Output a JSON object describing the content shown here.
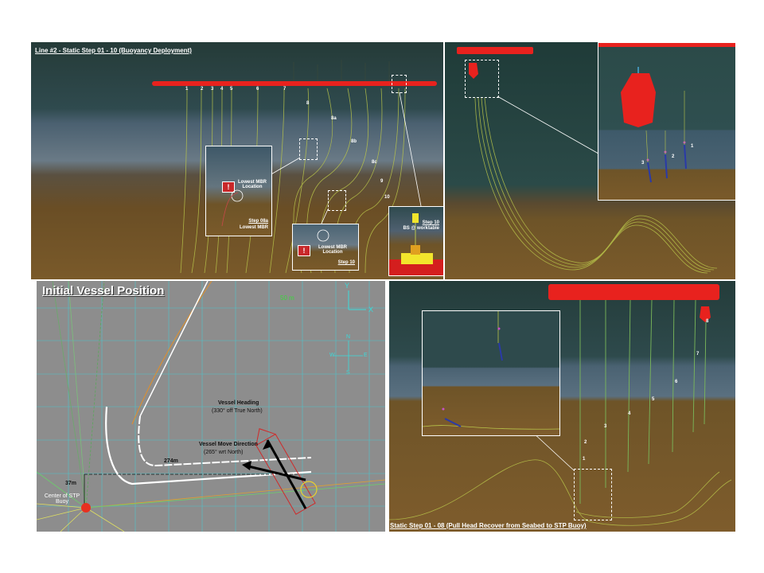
{
  "panel1": {
    "title": "Line #2 - Static Step 01 - 10 (Buoyancy Deployment)",
    "line_numbers": [
      "1",
      "2",
      "3",
      "4",
      "5",
      "6",
      "7",
      "8",
      "8a",
      "8b",
      "8c",
      "9",
      "10"
    ],
    "inset_a": {
      "warning_text": "Lowest MBR Location",
      "step": "Step 08a",
      "caption": "Lowest MBR"
    },
    "inset_b": {
      "warning_text": "Lowest MBR Location",
      "step": "Step 10"
    },
    "inset_c": {
      "step": "Step 10",
      "caption": "BS @ worktable"
    }
  },
  "panel2": {
    "labels": [
      "1",
      "2",
      "3"
    ]
  },
  "panel3": {
    "title": "Initial Vessel Position",
    "scale": "50 m",
    "axis_y": "Y",
    "axis_x": "X",
    "compass": {
      "n": "N",
      "s": "S",
      "e": "E",
      "w": "W"
    },
    "heading_label": "Vessel Heading",
    "heading_value": "(330° off True North)",
    "move_label": "Vessel Move Direction",
    "move_value": "(265° wrt North)",
    "dist_h": "274m",
    "dist_v": "37m",
    "center_label": "Center of STP Buoy"
  },
  "panel4": {
    "line_numbers": [
      "1",
      "2",
      "3",
      "4",
      "5",
      "6",
      "7",
      "8"
    ],
    "caption": "Static Step 01 - 08 (Pull Head Recover from Seabed to STP Buoy)"
  }
}
